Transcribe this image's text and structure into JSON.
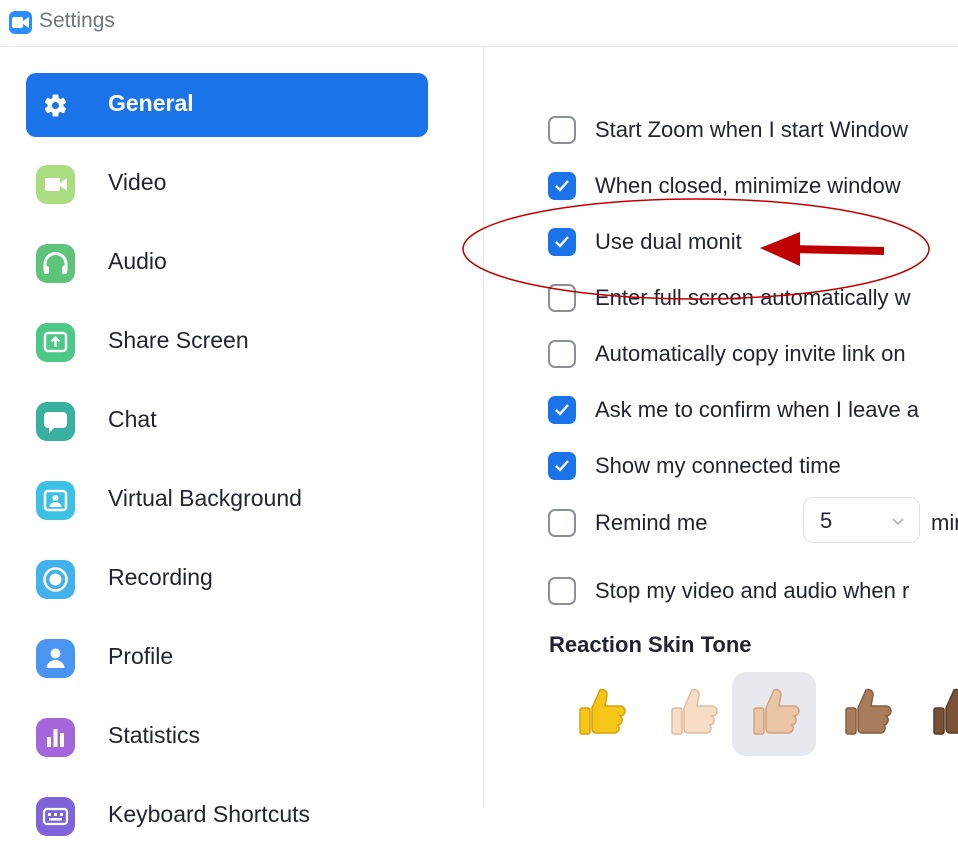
{
  "window": {
    "title": "Settings",
    "icon": "zoom-camera-icon"
  },
  "colors": {
    "accent": "#1a73e8",
    "annotation": "#c00000"
  },
  "sidebar": {
    "items": [
      {
        "label": "General",
        "icon": "gear-icon",
        "color": "#1a73e8",
        "active": true
      },
      {
        "label": "Video",
        "icon": "video-camera-icon",
        "color": "#8fd36b"
      },
      {
        "label": "Audio",
        "icon": "headphones-icon",
        "color": "#4caf6e"
      },
      {
        "label": "Share Screen",
        "icon": "share-screen-icon",
        "color": "#3fbf7a"
      },
      {
        "label": "Chat",
        "icon": "chat-bubble-icon",
        "color": "#36a896"
      },
      {
        "label": "Virtual Background",
        "icon": "virtual-background-icon",
        "color": "#35b8e0"
      },
      {
        "label": "Recording",
        "icon": "record-icon",
        "color": "#3aaee8"
      },
      {
        "label": "Profile",
        "icon": "person-icon",
        "color": "#3d8ef0"
      },
      {
        "label": "Statistics",
        "icon": "bar-chart-icon",
        "color": "#9b5ed6"
      },
      {
        "label": "Keyboard Shortcuts",
        "icon": "keyboard-icon",
        "color": "#7a5cd6"
      }
    ]
  },
  "general": {
    "options": [
      {
        "label": "Start Zoom when I start Window",
        "checked": false
      },
      {
        "label": "When closed, minimize window",
        "checked": true
      },
      {
        "label": "Use dual monit",
        "checked": true
      },
      {
        "label": "Enter full screen automatically w",
        "checked": false
      },
      {
        "label": "Automatically copy invite link on",
        "checked": false
      },
      {
        "label": "Ask me to confirm when I leave a",
        "checked": true
      },
      {
        "label": "Show my connected time",
        "checked": true
      },
      {
        "label": "Remind me",
        "checked": false,
        "stepper_value": "5",
        "suffix": "minutes"
      },
      {
        "label": "Stop my video and audio when r",
        "checked": false
      }
    ],
    "reaction_title": "Reaction Skin Tone",
    "reaction_tones": [
      {
        "name": "default-yellow",
        "color": "#f5c518",
        "selected": false
      },
      {
        "name": "light",
        "color": "#f7d9c0",
        "selected": false
      },
      {
        "name": "medium-light",
        "color": "#e8c1a0",
        "selected": true
      },
      {
        "name": "medium",
        "color": "#a87a5a",
        "selected": false
      },
      {
        "name": "medium-dark",
        "color": "#7a5238",
        "selected": false
      }
    ]
  }
}
